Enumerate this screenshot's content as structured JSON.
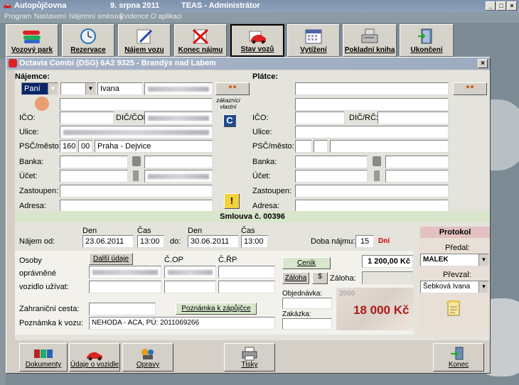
{
  "app": {
    "title": "Autopůjčovna",
    "date": "9. srpna 2011",
    "user": "TEAS - Administrátor",
    "btn_min": "_",
    "btn_max": "□",
    "btn_close": "×"
  },
  "menu": [
    "Program",
    "Nastavení",
    "Nájemní smlouvy",
    "Evidence",
    "O aplikaci"
  ],
  "toolbar": [
    {
      "label": "Vozový park",
      "icon": "cars-icon"
    },
    {
      "label": "Rezervace",
      "icon": "clock-icon"
    },
    {
      "label": "Nájem vozu",
      "icon": "pencil-icon"
    },
    {
      "label": "Konec nájmu",
      "icon": "cancel-icon"
    },
    {
      "label": "Stav vozů",
      "icon": "car-icon"
    },
    {
      "label": "Vytížení",
      "icon": "calendar-icon"
    },
    {
      "label": "Pokladní kniha",
      "icon": "cash-register-icon"
    },
    {
      "label": "Ukončení",
      "icon": "exit-icon"
    }
  ],
  "dialog": {
    "title": "Octavia Combi (DSG) 6A2 9325 - Brandýs nad Labem",
    "close": "×"
  },
  "najemce": {
    "heading": "Nájemce:",
    "salutation": "Paní",
    "first_name": "Ivana",
    "ico_label": "IČO:",
    "dic_label": "DIČ/ČOP:",
    "ulice_label": "Ulice:",
    "psc_label": "PSČ/město:",
    "psc1": "160",
    "psc2": "00",
    "city": "Praha - Dejvice",
    "banka_label": "Banka:",
    "ucet_label": "Účet:",
    "zastoupen_label": "Zastoupen:",
    "adresa_label": "Adresa:"
  },
  "customers_label": "zákazníci vlastní",
  "platce": {
    "heading": "Plátce:",
    "ico_label": "IČO:",
    "dic_label": "DIČ/RČ:",
    "ulice_label": "Ulice:",
    "psc_label": "PSČ/město:",
    "banka_label": "Banka:",
    "ucet_label": "Účet:",
    "zastoupen_label": "Zastoupen:",
    "adresa_label": "Adresa:"
  },
  "contract": {
    "title": "Smlouva č. 00396",
    "najem_label": "Nájem od:",
    "den_label": "Den",
    "cas_label": "Čas",
    "do_label": "do:",
    "from_date": "23.06.2011",
    "from_time": "13:00",
    "to_date": "30.06.2011",
    "to_time": "13:00",
    "doba_label": "Doba nájmu:",
    "days": "15",
    "dni_label": "Dní"
  },
  "persons": {
    "line1": "Osoby",
    "line2": "oprávněné",
    "line3": "vozidlo užívat:",
    "dalsi_btn": "Další údaje",
    "cop_label": "Č.OP",
    "crp_label": "Č.ŘP",
    "zahranicni_label": "Zahraniční cesta:",
    "poznamka_btn": "Poznámka k zápůjčce",
    "poznamka_label": "Poznámka k vozu:",
    "poznamka_value": "NEHODA - ACA, PÚ: 2011069266"
  },
  "pricing": {
    "cenik_btn": "Ceník",
    "price": "1 200,00 Kč",
    "zaloha_btn": "Záloha",
    "zaloha_label": "Záloha:",
    "objednavka_label": "Objednávka:",
    "zakazka_label": "Zakázka:",
    "total": "18 000 Kč",
    "banknote": "2000"
  },
  "protokol": {
    "title": "Protokol",
    "predal_label": "Předal:",
    "predal_value": "MALEK",
    "prevzal_label": "Převzal:",
    "prevzal_value": "Šebková Ivana"
  },
  "bottom": {
    "dokumenty": "Dokumenty",
    "udaje": "Údaje o vozidle",
    "opravy": "Opravy",
    "tisky": "Tisky",
    "konec": "Konec"
  }
}
